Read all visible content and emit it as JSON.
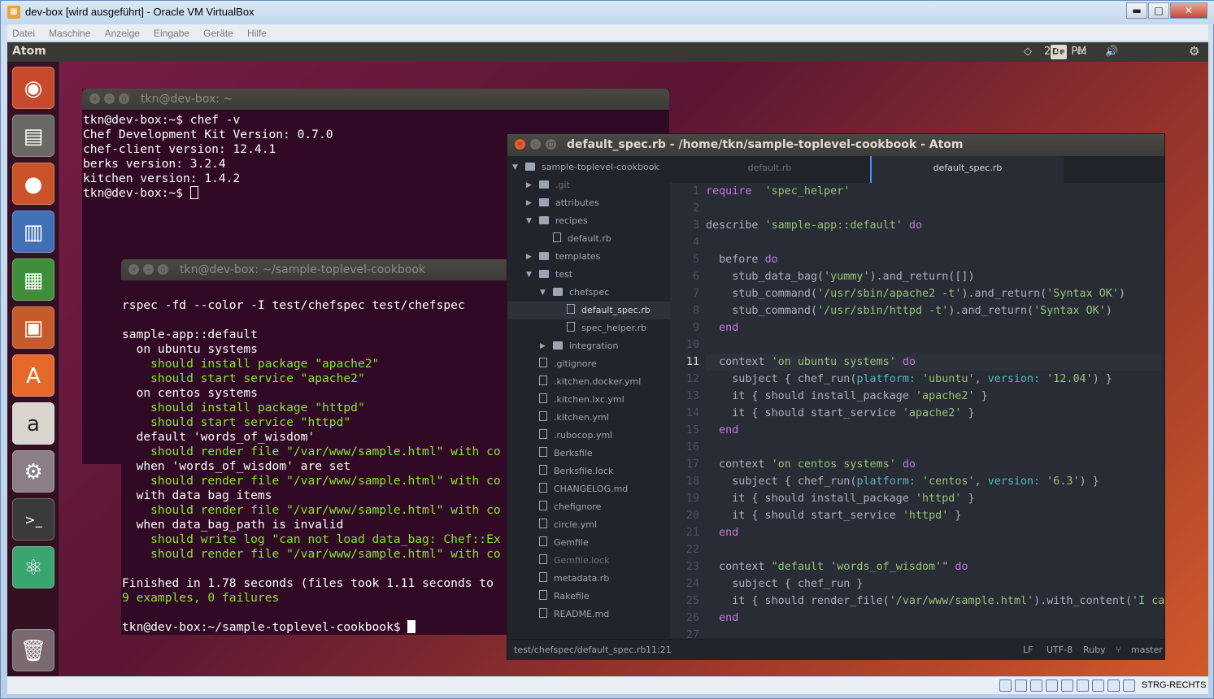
{
  "vbox": {
    "title": "dev-box [wird ausgeführt] - Oracle VM VirtualBox",
    "menu": [
      "Datei",
      "Maschine",
      "Anzeige",
      "Eingabe",
      "Geräte",
      "Hilfe"
    ],
    "controls": {
      "minimize": "▬",
      "maximize": "□",
      "close": "✕"
    },
    "host_key": "STRG-RECHTS"
  },
  "ubuntu": {
    "app_name": "Atom",
    "keyboard_layout": "De",
    "clock": "2:41 PM",
    "launcher": [
      "ubuntu-logo-icon",
      "files-icon",
      "firefox-icon",
      "writer-icon",
      "calc-icon",
      "impress-icon",
      "software-center-icon",
      "amazon-icon",
      "settings-icon",
      "terminal-icon",
      "atom-icon",
      "trash-icon"
    ]
  },
  "term1": {
    "title": "tkn@dev-box: ~",
    "lines": [
      "tkn@dev-box:~$ chef -v",
      "Chef Development Kit Version: 0.7.0",
      "chef-client version: 12.4.1",
      "berks version: 3.2.4",
      "kitchen version: 1.4.2",
      "tkn@dev-box:~$ "
    ]
  },
  "term2": {
    "title": "tkn@dev-box: ~/sample-toplevel-cookbook",
    "lines": [
      {
        "t": "",
        "c": "w"
      },
      {
        "t": "rspec -fd --color -I test/chefspec test/chefspec",
        "c": "w"
      },
      {
        "t": "",
        "c": "w"
      },
      {
        "t": "sample-app::default",
        "c": "w"
      },
      {
        "t": "  on ubuntu systems",
        "c": "w"
      },
      {
        "t": "    should install package \"apache2\"",
        "c": "g"
      },
      {
        "t": "    should start service \"apache2\"",
        "c": "g"
      },
      {
        "t": "  on centos systems",
        "c": "w"
      },
      {
        "t": "    should install package \"httpd\"",
        "c": "g"
      },
      {
        "t": "    should start service \"httpd\"",
        "c": "g"
      },
      {
        "t": "  default 'words_of_wisdom'",
        "c": "w"
      },
      {
        "t": "    should render file \"/var/www/sample.html\" with co",
        "c": "g"
      },
      {
        "t": "  when 'words_of_wisdom' are set",
        "c": "w"
      },
      {
        "t": "    should render file \"/var/www/sample.html\" with co",
        "c": "g"
      },
      {
        "t": "  with data bag items",
        "c": "w"
      },
      {
        "t": "    should render file \"/var/www/sample.html\" with co",
        "c": "g"
      },
      {
        "t": "  when data_bag_path is invalid",
        "c": "w"
      },
      {
        "t": "    should write log \"can not load data_bag: Chef::Ex",
        "c": "g"
      },
      {
        "t": "    should render file \"/var/www/sample.html\" with co",
        "c": "g"
      },
      {
        "t": "",
        "c": "w"
      },
      {
        "t": "Finished in 1.78 seconds (files took 1.11 seconds to",
        "c": "w"
      },
      {
        "t": "9 examples, 0 failures",
        "c": "g"
      },
      {
        "t": "",
        "c": "w"
      },
      {
        "t": "tkn@dev-box:~/sample-toplevel-cookbook$ ",
        "c": "w"
      }
    ]
  },
  "atom": {
    "title": "default_spec.rb - /home/tkn/sample-toplevel-cookbook - Atom",
    "tabs": [
      "default.rb",
      "default_spec.rb"
    ],
    "tree": [
      {
        "label": "sample-toplevel-cookbook",
        "kind": "repo",
        "depth": 0,
        "arrow": "down"
      },
      {
        "label": ".git",
        "kind": "folder",
        "depth": 1,
        "arrow": "right",
        "dim": true
      },
      {
        "label": "attributes",
        "kind": "folder",
        "depth": 1,
        "arrow": "right"
      },
      {
        "label": "recipes",
        "kind": "folder",
        "depth": 1,
        "arrow": "down"
      },
      {
        "label": "default.rb",
        "kind": "file",
        "depth": 2
      },
      {
        "label": "templates",
        "kind": "folder",
        "depth": 1,
        "arrow": "right"
      },
      {
        "label": "test",
        "kind": "folder",
        "depth": 1,
        "arrow": "down"
      },
      {
        "label": "chefspec",
        "kind": "folder",
        "depth": 2,
        "arrow": "down"
      },
      {
        "label": "default_spec.rb",
        "kind": "file",
        "depth": 3,
        "selected": true
      },
      {
        "label": "spec_helper.rb",
        "kind": "file",
        "depth": 3
      },
      {
        "label": "integration",
        "kind": "folder",
        "depth": 2,
        "arrow": "right"
      },
      {
        "label": ".gitignore",
        "kind": "file",
        "depth": 1
      },
      {
        "label": ".kitchen.docker.yml",
        "kind": "file",
        "depth": 1
      },
      {
        "label": ".kitchen.lxc.yml",
        "kind": "file",
        "depth": 1
      },
      {
        "label": ".kitchen.yml",
        "kind": "file",
        "depth": 1
      },
      {
        "label": ".rubocop.yml",
        "kind": "file",
        "depth": 1
      },
      {
        "label": "Berksfile",
        "kind": "file",
        "depth": 1
      },
      {
        "label": "Berksfile.lock",
        "kind": "file",
        "depth": 1
      },
      {
        "label": "CHANGELOG.md",
        "kind": "file",
        "depth": 1
      },
      {
        "label": "chefignore",
        "kind": "file",
        "depth": 1
      },
      {
        "label": "circle.yml",
        "kind": "file",
        "depth": 1
      },
      {
        "label": "Gemfile",
        "kind": "file",
        "depth": 1
      },
      {
        "label": "Gemfile.lock",
        "kind": "file",
        "depth": 1,
        "dim": true
      },
      {
        "label": "metadata.rb",
        "kind": "file",
        "depth": 1
      },
      {
        "label": "Rakefile",
        "kind": "file",
        "depth": 1
      },
      {
        "label": "README.md",
        "kind": "file",
        "depth": 1
      }
    ],
    "code": [
      [
        [
          "kw",
          "require"
        ],
        [
          "",
          "  "
        ],
        [
          "st",
          "'spec_helper'"
        ]
      ],
      [],
      [
        [
          "",
          "describe "
        ],
        [
          "st",
          "'sample-app::default'"
        ],
        [
          "kw",
          " do"
        ]
      ],
      [],
      [
        [
          "",
          "  before "
        ],
        [
          "kw",
          "do"
        ]
      ],
      [
        [
          "",
          "    stub_data_bag("
        ],
        [
          "st",
          "'yummy'"
        ],
        [
          "",
          ").and_return([])"
        ]
      ],
      [
        [
          "",
          "    stub_command("
        ],
        [
          "st",
          "'/usr/sbin/apache2 -t'"
        ],
        [
          "",
          ").and_return("
        ],
        [
          "st",
          "'Syntax OK'"
        ],
        [
          "",
          ")"
        ]
      ],
      [
        [
          "",
          "    stub_command("
        ],
        [
          "st",
          "'/usr/sbin/httpd -t'"
        ],
        [
          "",
          ").and_return("
        ],
        [
          "st",
          "'Syntax OK'"
        ],
        [
          "",
          ")"
        ]
      ],
      [
        [
          "kw",
          "  end"
        ]
      ],
      [],
      [
        [
          "",
          "  context "
        ],
        [
          "st",
          "'on ubuntu systems'"
        ],
        [
          "kw",
          " do"
        ]
      ],
      [
        [
          "",
          "    subject { chef_run("
        ],
        [
          "cn",
          "platform:"
        ],
        [
          "st",
          " 'ubuntu'"
        ],
        [
          "",
          ", "
        ],
        [
          "cn",
          "version:"
        ],
        [
          "st",
          " '12.04'"
        ],
        [
          "",
          ") }"
        ]
      ],
      [
        [
          "",
          "    it { should install_package "
        ],
        [
          "st",
          "'apache2'"
        ],
        [
          "",
          " }"
        ]
      ],
      [
        [
          "",
          "    it { should start_service "
        ],
        [
          "st",
          "'apache2'"
        ],
        [
          "",
          " }"
        ]
      ],
      [
        [
          "kw",
          "  end"
        ]
      ],
      [],
      [
        [
          "",
          "  context "
        ],
        [
          "st",
          "'on centos systems'"
        ],
        [
          "kw",
          " do"
        ]
      ],
      [
        [
          "",
          "    subject { chef_run("
        ],
        [
          "cn",
          "platform:"
        ],
        [
          "st",
          " 'centos'"
        ],
        [
          "",
          ", "
        ],
        [
          "cn",
          "version:"
        ],
        [
          "st",
          " '6.3'"
        ],
        [
          "",
          ") }"
        ]
      ],
      [
        [
          "",
          "    it { should install_package "
        ],
        [
          "st",
          "'httpd'"
        ],
        [
          "",
          " }"
        ]
      ],
      [
        [
          "",
          "    it { should start_service "
        ],
        [
          "st",
          "'httpd'"
        ],
        [
          "",
          " }"
        ]
      ],
      [
        [
          "kw",
          "  end"
        ]
      ],
      [],
      [
        [
          "",
          "  context "
        ],
        [
          "st",
          "\"default 'words_of_wisdom'\""
        ],
        [
          "kw",
          " do"
        ]
      ],
      [
        [
          "",
          "    subject { chef_run }"
        ]
      ],
      [
        [
          "",
          "    it { should render_file("
        ],
        [
          "st",
          "'/var/www/sample.html'"
        ],
        [
          "",
          ").with_content("
        ],
        [
          "st",
          "'I ca"
        ]
      ],
      [
        [
          "kw",
          "  end"
        ]
      ],
      []
    ],
    "current_line": 11,
    "status": {
      "path": "test/chefspec/default_spec.rb",
      "cursor": "11:21",
      "eol": "LF",
      "encoding": "UTF-8",
      "grammar": "Ruby",
      "branch": "master"
    }
  }
}
